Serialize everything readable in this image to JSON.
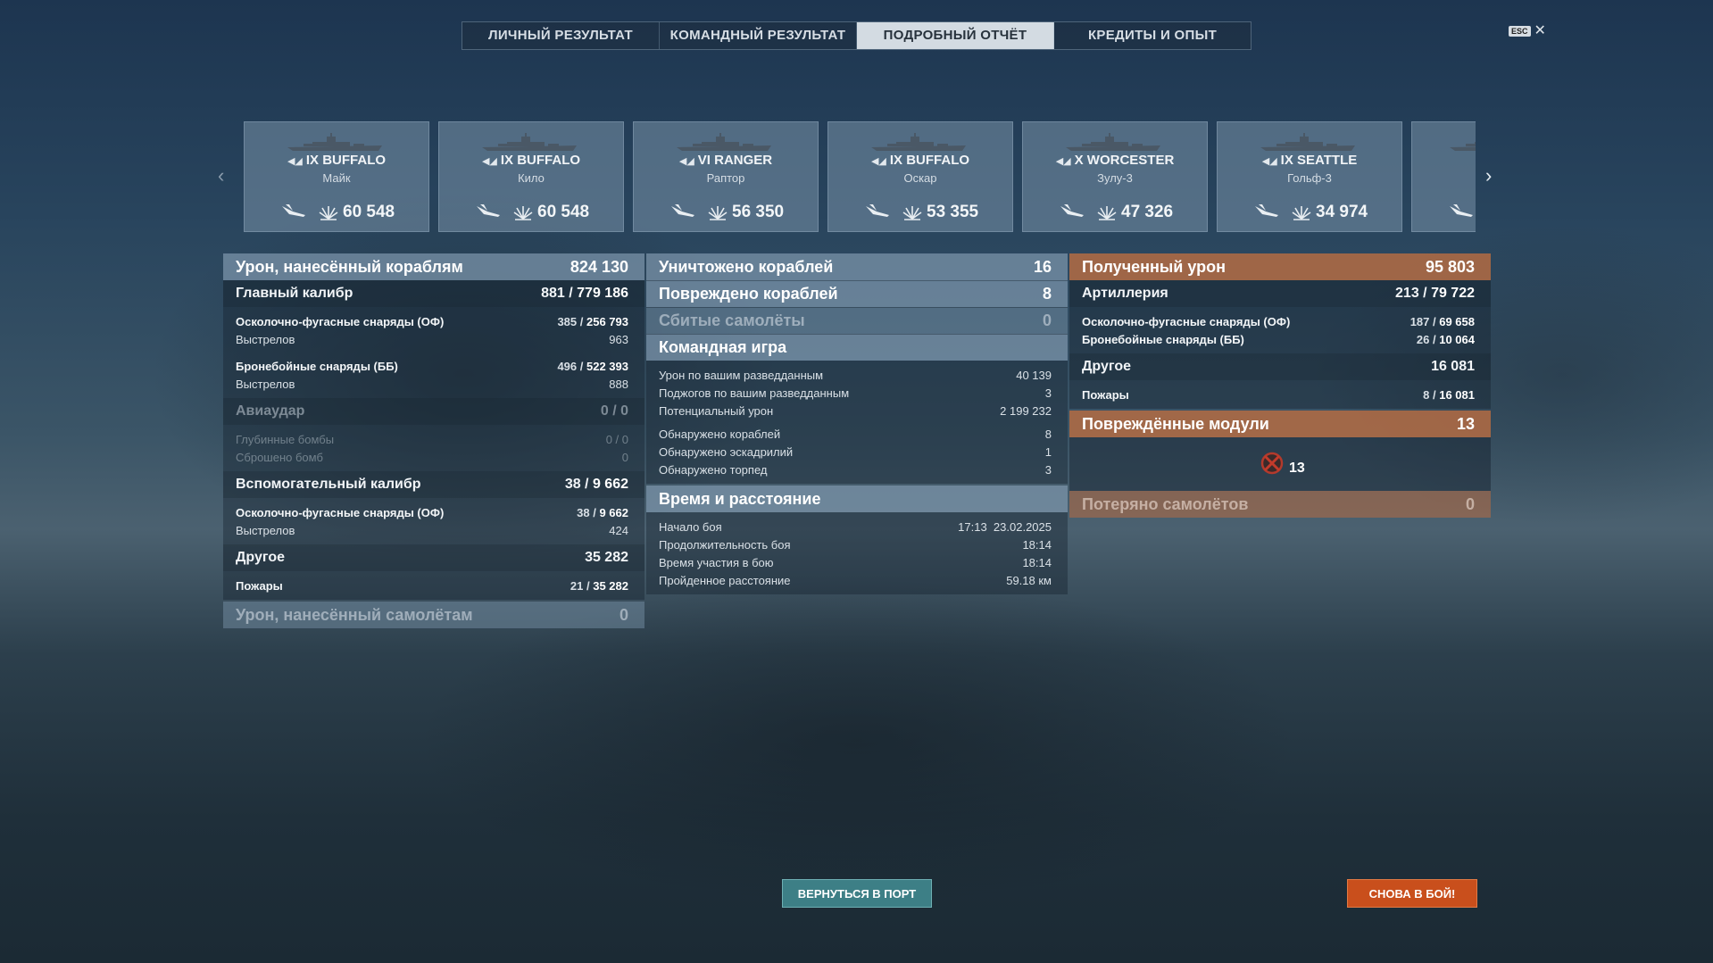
{
  "tabs": [
    {
      "label": "ЛИЧНЫЙ РЕЗУЛЬТАТ"
    },
    {
      "label": "КОМАНДНЫЙ РЕЗУЛЬТАТ"
    },
    {
      "label": "ПОДРОБНЫЙ ОТЧЁТ"
    },
    {
      "label": "КРЕДИТЫ И ОПЫТ"
    }
  ],
  "active_tab": "ПОДРОБНЫЙ ОТЧЁТ",
  "esc": {
    "key": "ESC",
    "close": "✕"
  },
  "carousel": {
    "left_arrow": "‹",
    "right_arrow": "›",
    "ships": [
      {
        "tier_name": "IX BUFFALO",
        "player": "Майк",
        "damage": "60 548"
      },
      {
        "tier_name": "IX BUFFALO",
        "player": "Кило",
        "damage": "60 548"
      },
      {
        "tier_name": "VI RANGER",
        "player": "Раптор",
        "damage": "56 350"
      },
      {
        "tier_name": "IX BUFFALO",
        "player": "Оскар",
        "damage": "53 355"
      },
      {
        "tier_name": "X WORCESTER",
        "player": "Зулу-3",
        "damage": "47 326"
      },
      {
        "tier_name": "IX SEATTLE",
        "player": "Гольф-3",
        "damage": "34 974"
      }
    ]
  },
  "left": {
    "ship_damage": {
      "label": "Урон, нанесённый кораблям",
      "value": "824 130"
    },
    "main_caliber": {
      "label": "Главный калибр",
      "hits": "881",
      "value": "779 186"
    },
    "he_shells": {
      "label": "Осколочно-фугасные снаряды (ОФ)",
      "hits": "385",
      "value": "256 793"
    },
    "he_shots": {
      "label": "Выстрелов",
      "value": "963"
    },
    "ap_shells": {
      "label": "Бронебойные снаряды (ББ)",
      "hits": "496",
      "value": "522 393"
    },
    "ap_shots": {
      "label": "Выстрелов",
      "value": "888"
    },
    "airstrike": {
      "label": "Авиаудар",
      "value": "0 / 0"
    },
    "depth_charges": {
      "label": "Глубинные бомбы",
      "value": "0 / 0"
    },
    "bombs_dropped": {
      "label": "Сброшено бомб",
      "value": "0"
    },
    "secondary": {
      "label": "Вспомогательный калибр",
      "hits": "38",
      "value": "9 662"
    },
    "sec_he": {
      "label": "Осколочно-фугасные снаряды (ОФ)",
      "hits": "38",
      "value": "9 662"
    },
    "sec_shots": {
      "label": "Выстрелов",
      "value": "424"
    },
    "other": {
      "label": "Другое",
      "value": "35 282"
    },
    "fires": {
      "label": "Пожары",
      "hits": "21",
      "value": "35 282"
    },
    "plane_damage": {
      "label": "Урон, нанесённый самолётам",
      "value": "0"
    }
  },
  "middle": {
    "destroyed": {
      "label": "Уничтожено кораблей",
      "value": "16"
    },
    "damaged": {
      "label": "Повреждено кораблей",
      "value": "8"
    },
    "planes_shot": {
      "label": "Сбитые самолёты",
      "value": "0"
    },
    "team_play": {
      "label": "Командная игра"
    },
    "spot_damage": {
      "label": "Урон по вашим разведданным",
      "value": "40 139"
    },
    "spot_fires": {
      "label": "Поджогов по вашим разведданным",
      "value": "3"
    },
    "potential": {
      "label": "Потенциальный урон",
      "value": "2 199 232"
    },
    "spotted_ships": {
      "label": "Обнаружено кораблей",
      "value": "8"
    },
    "spotted_squadrons": {
      "label": "Обнаружено эскадрилий",
      "value": "1"
    },
    "spotted_torps": {
      "label": "Обнаружено торпед",
      "value": "3"
    },
    "time_distance": {
      "label": "Время и расстояние"
    },
    "battle_start": {
      "label": "Начало боя",
      "value": "17:13  23.02.2025"
    },
    "battle_duration": {
      "label": "Продолжительность боя",
      "value": "18:14"
    },
    "time_in_battle": {
      "label": "Время участия в бою",
      "value": "18:14"
    },
    "distance": {
      "label": "Пройденное расстояние",
      "value": "59.18 км"
    }
  },
  "right": {
    "received": {
      "label": "Полученный урон",
      "value": "95 803"
    },
    "artillery": {
      "label": "Артиллерия",
      "hits": "213",
      "value": "79 722"
    },
    "he": {
      "label": "Осколочно-фугасные снаряды (ОФ)",
      "hits": "187",
      "value": "69 658"
    },
    "ap": {
      "label": "Бронебойные снаряды (ББ)",
      "hits": "26",
      "value": "10 064"
    },
    "other": {
      "label": "Другое",
      "value": "16 081"
    },
    "fires": {
      "label": "Пожары",
      "hits": "8",
      "value": "16 081"
    },
    "modules": {
      "label": "Повреждённые модули",
      "value": "13",
      "icon_count": "13"
    },
    "planes_lost": {
      "label": "Потеряно самолётов",
      "value": "0"
    }
  },
  "buttons": {
    "port": "ВЕРНУТЬСЯ В ПОРТ",
    "battle": "СНОВА В БОЙ!"
  },
  "colors": {
    "accent_orange": "#c94f1c",
    "teal": "#3d7f86",
    "panel_blue": "#7d96ac",
    "panel_orange": "#b86c42"
  }
}
